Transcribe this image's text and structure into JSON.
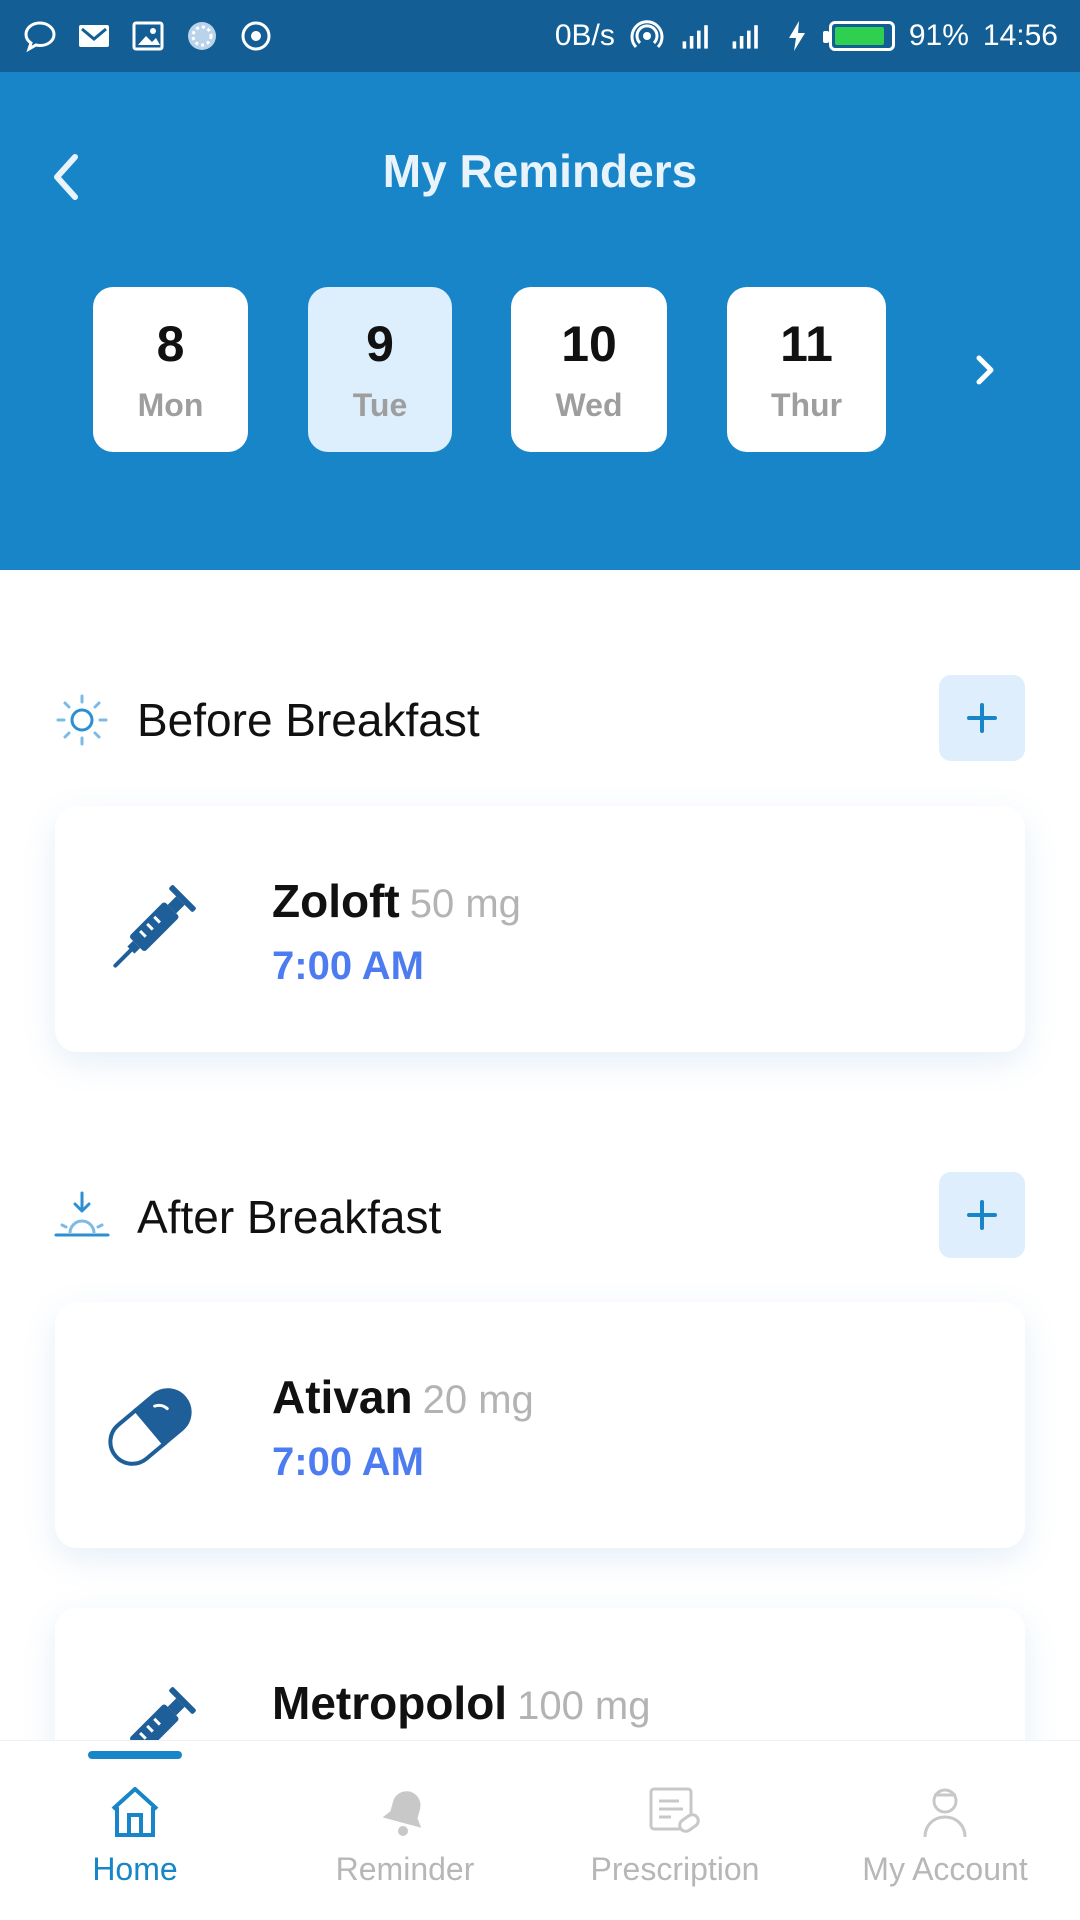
{
  "status_bar": {
    "net_speed": "0B/s",
    "battery_percent": "91%",
    "battery_level": 0.91,
    "time": "14:56",
    "left_icons": [
      "chat-icon",
      "mail-icon",
      "gallery-icon",
      "loading-icon",
      "target-icon"
    ],
    "right_icons": [
      "hotspot-icon",
      "signal-icon",
      "signal-icon",
      "charging-icon",
      "battery-icon"
    ]
  },
  "header": {
    "title": "My Reminders",
    "back_icon": "chevron-left-icon",
    "next_icon": "chevron-right-icon",
    "days": [
      {
        "num": "8",
        "weekday": "Mon",
        "selected": false
      },
      {
        "num": "9",
        "weekday": "Tue",
        "selected": true
      },
      {
        "num": "10",
        "weekday": "Wed",
        "selected": false
      },
      {
        "num": "11",
        "weekday": "Thur",
        "selected": false
      }
    ]
  },
  "sections": [
    {
      "title": "Before Breakfast",
      "icon": "sun-icon",
      "add_icon": "plus-icon",
      "items": [
        {
          "name": "Zoloft",
          "dose": "50 mg",
          "time": "7:00 AM",
          "icon": "syringe-icon"
        }
      ]
    },
    {
      "title": "After Breakfast",
      "icon": "sunrise-icon",
      "add_icon": "plus-icon",
      "items": [
        {
          "name": "Ativan",
          "dose": "20 mg",
          "time": "7:00 AM",
          "icon": "capsule-icon"
        },
        {
          "name": "Metropolol",
          "dose": "100 mg",
          "time": "",
          "icon": "syringe-icon"
        }
      ]
    }
  ],
  "bottom_nav": [
    {
      "label": "Home",
      "icon": "home-icon",
      "active": true
    },
    {
      "label": "Reminder",
      "icon": "bell-icon",
      "active": false
    },
    {
      "label": "Prescription",
      "icon": "prescription-icon",
      "active": false
    },
    {
      "label": "My Account",
      "icon": "user-icon",
      "active": false
    }
  ],
  "colors": {
    "status_bar": "#135f95",
    "header": "#1885c8",
    "selected_day": "#ddeefc",
    "time_text": "#4d7cf0",
    "dose_text": "#b3b3b3",
    "inactive_nav": "#b7b7b7"
  }
}
